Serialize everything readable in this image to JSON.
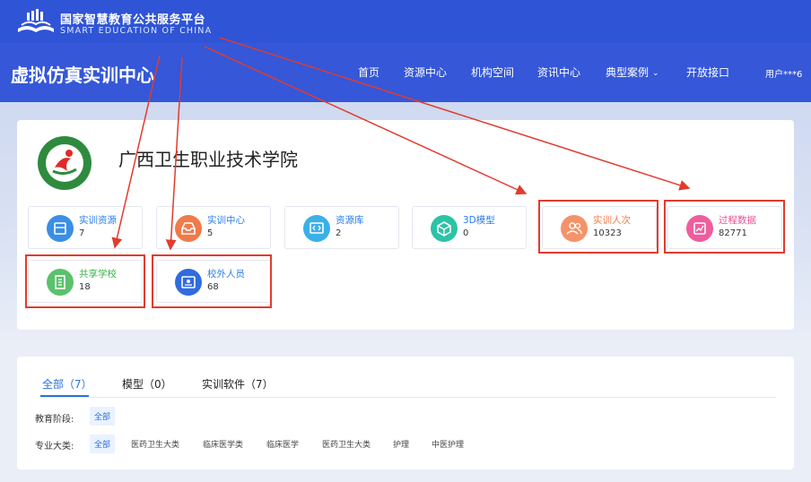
{
  "brand": {
    "name_cn": "国家智慧教育公共服务平台",
    "name_en": "SMART EDUCATION OF CHINA",
    "logo_icon": "open-book-icon"
  },
  "nav": {
    "site_title": "虚拟仿真实训中心",
    "items": [
      "首页",
      "资源中心",
      "机构空间",
      "资讯中心",
      "典型案例",
      "开放接口"
    ],
    "dropdown_icon": "chevron-down-icon",
    "user": "用户***6"
  },
  "school": {
    "name": "广西卫生职业技术学院",
    "logo_icon": "school-emblem-icon"
  },
  "stats": [
    {
      "label": "实训资源",
      "value": "7",
      "icon": "printer-icon",
      "color": "#3a8ee6"
    },
    {
      "label": "实训中心",
      "value": "5",
      "icon": "inbox-icon",
      "color": "#f07a4a"
    },
    {
      "label": "资源库",
      "value": "2",
      "icon": "code-window-icon",
      "color": "#3ab0e8"
    },
    {
      "label": "3D模型",
      "value": "0",
      "icon": "cube-icon",
      "color": "#2cc3a7"
    },
    {
      "label": "实训人次",
      "value": "10323",
      "icon": "users-icon",
      "color": "#f4936a"
    },
    {
      "label": "过程数据",
      "value": "82771",
      "icon": "chart-icon",
      "color": "#ef5d9e"
    },
    {
      "label": "共享学校",
      "value": "18",
      "icon": "building-icon",
      "color": "#5ac26b"
    },
    {
      "label": "校外人员",
      "value": "68",
      "icon": "id-card-icon",
      "color": "#2f6ce0"
    }
  ],
  "accent_colors": {
    "label_blue": "#2b7de9",
    "label_green": "#3db24b",
    "label_orange": "#f07a4a",
    "label_pink": "#ea4f95",
    "highlight_red": "#e23b2e"
  },
  "tabs": [
    "全部（7）",
    "模型（0）",
    "实训软件（7）"
  ],
  "filters": {
    "stage_label": "教育阶段:",
    "stage_options": [
      "全部"
    ],
    "major_label": "专业大类:",
    "major_options": [
      "全部",
      "医药卫生大类",
      "临床医学类",
      "临床医学",
      "医药卫生大类",
      "护理",
      "中医护理"
    ]
  }
}
